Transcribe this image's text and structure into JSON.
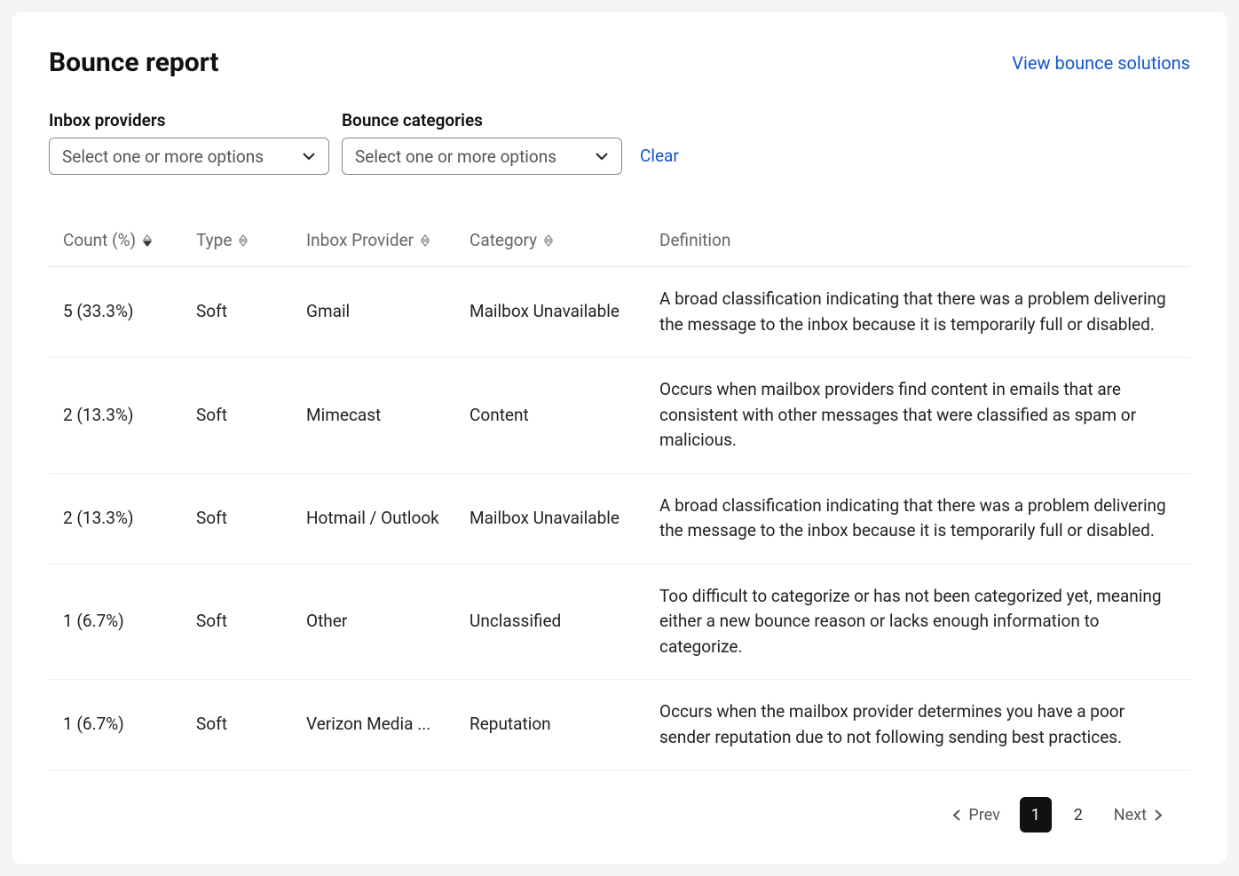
{
  "header": {
    "title": "Bounce report",
    "solutions_link": "View bounce solutions"
  },
  "filters": {
    "inbox_providers": {
      "label": "Inbox providers",
      "placeholder": "Select one or more options"
    },
    "bounce_categories": {
      "label": "Bounce categories",
      "placeholder": "Select one or more options"
    },
    "clear": "Clear"
  },
  "table": {
    "columns": {
      "count": "Count (%)",
      "type": "Type",
      "provider": "Inbox Provider",
      "category": "Category",
      "definition": "Definition"
    },
    "rows": [
      {
        "count": "5 (33.3%)",
        "type": "Soft",
        "provider": "Gmail",
        "category": "Mailbox Unavailable",
        "definition": "A broad classification indicating that there was a problem delivering the message to the inbox because it is temporarily full or disabled."
      },
      {
        "count": "2 (13.3%)",
        "type": "Soft",
        "provider": "Mimecast",
        "category": "Content",
        "definition": "Occurs when mailbox providers find content in emails that are consistent with other messages that were classified as spam or malicious."
      },
      {
        "count": "2 (13.3%)",
        "type": "Soft",
        "provider": "Hotmail / Outlook",
        "category": "Mailbox Unavailable",
        "definition": "A broad classification indicating that there was a problem delivering the message to the inbox because it is temporarily full or disabled."
      },
      {
        "count": "1 (6.7%)",
        "type": "Soft",
        "provider": "Other",
        "category": "Unclassified",
        "definition": "Too difficult to categorize or has not been categorized yet, meaning either a new bounce reason or lacks enough information to categorize."
      },
      {
        "count": "1 (6.7%)",
        "type": "Soft",
        "provider": "Verizon Media ...",
        "category": "Reputation",
        "definition": "Occurs when the mailbox provider determines you have a poor sender reputation due to not following sending best practices."
      }
    ]
  },
  "pagination": {
    "prev": "Prev",
    "next": "Next",
    "pages": [
      "1",
      "2"
    ],
    "current": "1"
  }
}
